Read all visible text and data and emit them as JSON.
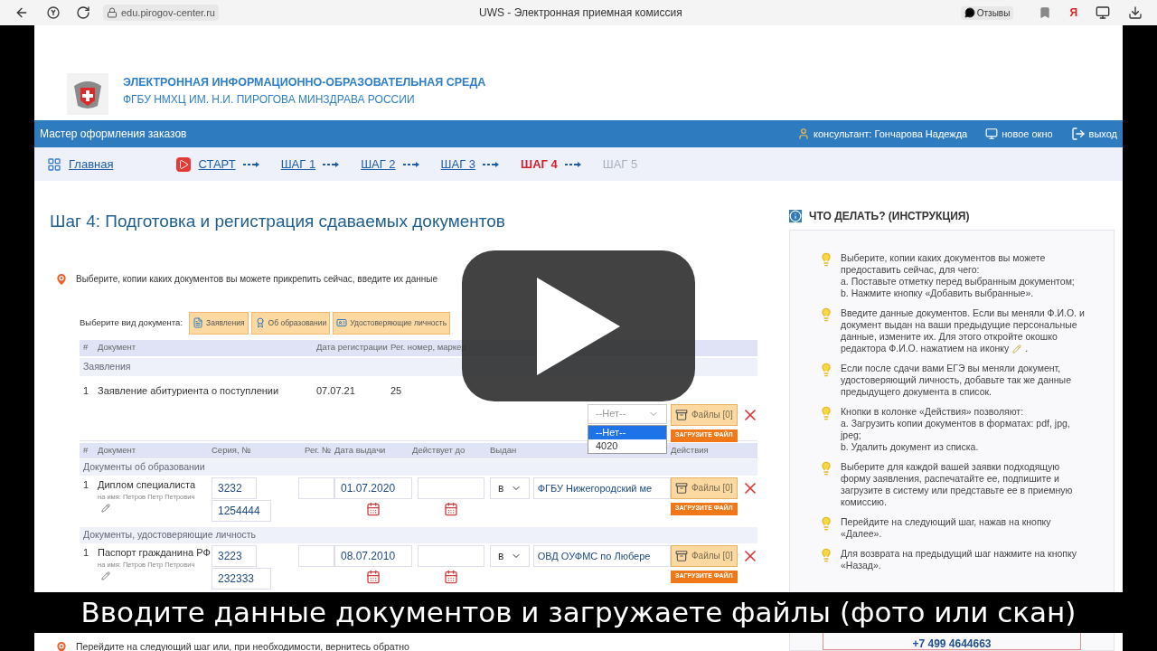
{
  "browser": {
    "url": "edu.pirogov-center.ru",
    "title": "UWS - Электронная приемная комиссия",
    "feedback": "Отзывы",
    "yandex": "Я"
  },
  "header": {
    "title": "ЭЛЕКТРОННАЯ ИНФОРМАЦИОННО-ОБРАЗОВАТЕЛЬНАЯ СРЕДА",
    "subtitle": "ФГБУ НМХЦ ИМ. Н.И. ПИРОГОВА МИНЗДРАВА РОССИИ"
  },
  "topbar": {
    "title": "Мастер оформления заказов",
    "consultant": "консультант: Гончарова Надежда",
    "new_window": "новое окно",
    "exit": "выход"
  },
  "steps": [
    {
      "label": "Главная",
      "kind": "home",
      "selected": false,
      "disabled": false
    },
    {
      "label": "СТАРТ",
      "kind": "start",
      "selected": false,
      "disabled": false
    },
    {
      "label": "ШАГ 1",
      "kind": "step",
      "selected": false,
      "disabled": false
    },
    {
      "label": "ШАГ 2",
      "kind": "step",
      "selected": false,
      "disabled": false
    },
    {
      "label": "ШАГ 3",
      "kind": "step",
      "selected": false,
      "disabled": false
    },
    {
      "label": "ШАГ 4",
      "kind": "step",
      "selected": true,
      "disabled": false
    },
    {
      "label": "ШАГ 5",
      "kind": "step",
      "selected": false,
      "disabled": true
    }
  ],
  "page_title": "Шаг 4: Подготовка и регистрация сдаваемых документов",
  "hint": "Выберите, копии каких документов вы можете прикрепить сейчас, введите их данные",
  "doc_types": {
    "label": "Выберите вид документа:",
    "buttons": [
      "Заявления",
      "Об образовании",
      "Удостоверяющие личность"
    ]
  },
  "applications_table": {
    "columns": [
      "#",
      "Документ",
      "Дата регистрации",
      "Рег. номер, маркер"
    ],
    "group": "Заявления",
    "rows": [
      {
        "num": "1",
        "document": "Заявление абитуриента о поступлении",
        "date": "07.07.21",
        "reg": "25",
        "application": "--Нет--",
        "files": "Файлы [0]",
        "upload": "ЗАГРУЗИТЕ ФАЙЛ"
      }
    ],
    "dropdown": [
      {
        "label": "--Нет--",
        "selected": true
      },
      {
        "label": "4020",
        "selected": false
      }
    ]
  },
  "documents_table": {
    "columns": [
      "#",
      "Документ",
      "Серия, №",
      "Рег. №",
      "Дата выдачи",
      "Действует до",
      "Выдан",
      "Действия"
    ],
    "groups": [
      {
        "title": "Документы об образовании",
        "rows": [
          {
            "num": "1",
            "document": "Диплом специалиста",
            "owner": "на имя: Петров Петр Петрович",
            "series": "3232",
            "number": "1254444",
            "issue_date": "01.07.2020",
            "issuer_prefix": "в",
            "issuer": "ФГБУ Нижегородский ме",
            "files": "Файлы [0]",
            "upload": "ЗАГРУЗИТЕ ФАЙЛ"
          }
        ]
      },
      {
        "title": "Документы, удостоверяющие личность",
        "rows": [
          {
            "num": "1",
            "document": "Паспорт гражданина РФ",
            "owner": "на имя: Петров Петр Петрович",
            "series": "3223",
            "number": "232333",
            "issue_date": "08.07.2010",
            "issuer_prefix": "в",
            "issuer": "ОВД ОУФМС по Любере",
            "files": "Файлы [0]",
            "upload": "ЗАГРУЗИТЕ ФАЙЛ"
          }
        ]
      }
    ]
  },
  "next_hint": "Перейдите на следующий шаг или, при необходимости, вернитесь обратно",
  "instructions": {
    "title": "ЧТО ДЕЛАТЬ? (ИНСТРУКЦИЯ)",
    "items": [
      {
        "lines": [
          "Выберите, копии каких документов вы можете предоставить сейчас, для чего:",
          "a. Поставьте отметку перед выбранным документом;",
          "b. Нажмите кнопку «Добавить выбранные»."
        ]
      },
      {
        "lines": [
          "Введите данные документов. Если вы меняли Ф.И.О. и",
          "документ выдан на ваши предыдущие персональные",
          "данные, измените их. Для этого откройте окошко",
          "редактора Ф.И.О. нажатием на иконку"
        ],
        "after_icon": "."
      },
      {
        "lines": [
          "Если после сдачи вами ЕГЭ вы меняли документ, удостоверяющий личность, добавьте так же данные предыдущего документа в список."
        ]
      },
      {
        "lines": [
          "Кнопки в колонке «Действия» позволяют:",
          "a. Загрузить копии документов в форматах: pdf, jpg, jpeg;",
          "b. Удалить документ из списка."
        ]
      },
      {
        "lines": [
          "Выберите для каждой вашей заявки подходящую форму заявления, распечатайте ее, подпишите и загрузите в систему или представьте ее в приемную комиссию."
        ]
      },
      {
        "lines": [
          "Перейдите на следующий шаг, нажав на кнопку «Далее»."
        ]
      },
      {
        "lines": [
          "Для возврата на предыдущий шаг нажмите на кнопку «Назад»."
        ]
      }
    ],
    "phone": "+7 499 4644663"
  },
  "subtitle": "Вводите данные документов и загружаете файлы (фото или скан)"
}
